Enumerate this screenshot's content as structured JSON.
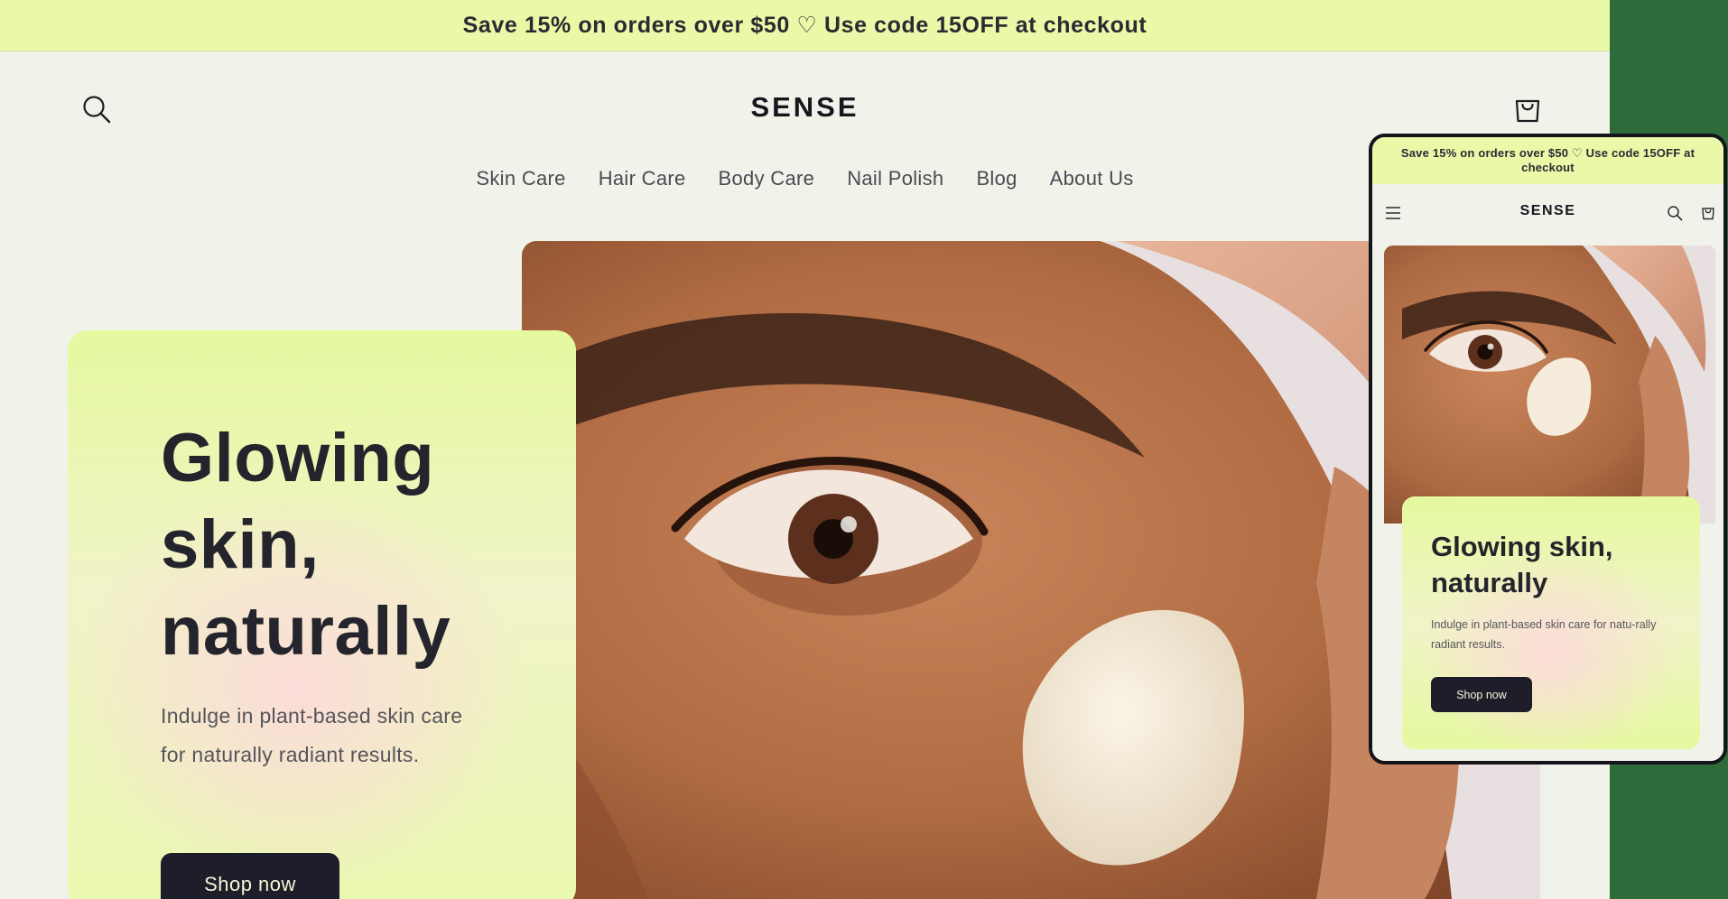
{
  "announcement": {
    "text": "Save 15% on orders over $50 ♡ Use code 15OFF at checkout"
  },
  "header": {
    "logo": "SENSE",
    "icons": {
      "search": "search-icon",
      "cart": "cart-icon",
      "menu": "menu-icon"
    }
  },
  "nav": {
    "items": [
      {
        "label": "Skin Care"
      },
      {
        "label": "Hair Care"
      },
      {
        "label": "Body Care"
      },
      {
        "label": "Nail Polish"
      },
      {
        "label": "Blog"
      },
      {
        "label": "About Us"
      }
    ]
  },
  "hero": {
    "title": "Glowing skin, naturally",
    "subtitle": "Indulge in plant-based skin care for naturally radiant results.",
    "cta_label": "Shop now"
  },
  "mobile": {
    "announcement": "Save 15% on orders over $50 ♡ Use code 15OFF at checkout",
    "logo": "SENSE",
    "hero_title": "Glowing skin, naturally",
    "hero_subtitle": "Indulge in plant-based skin care for natu-rally radiant results.",
    "cta_label": "Shop now"
  },
  "colors": {
    "announcement_bg": "#e9f9a8",
    "page_bg": "#f1f3ea",
    "button_bg": "#1e1e2a",
    "button_text": "#f4f7d6",
    "outer_bg": "#2f6b3a"
  }
}
